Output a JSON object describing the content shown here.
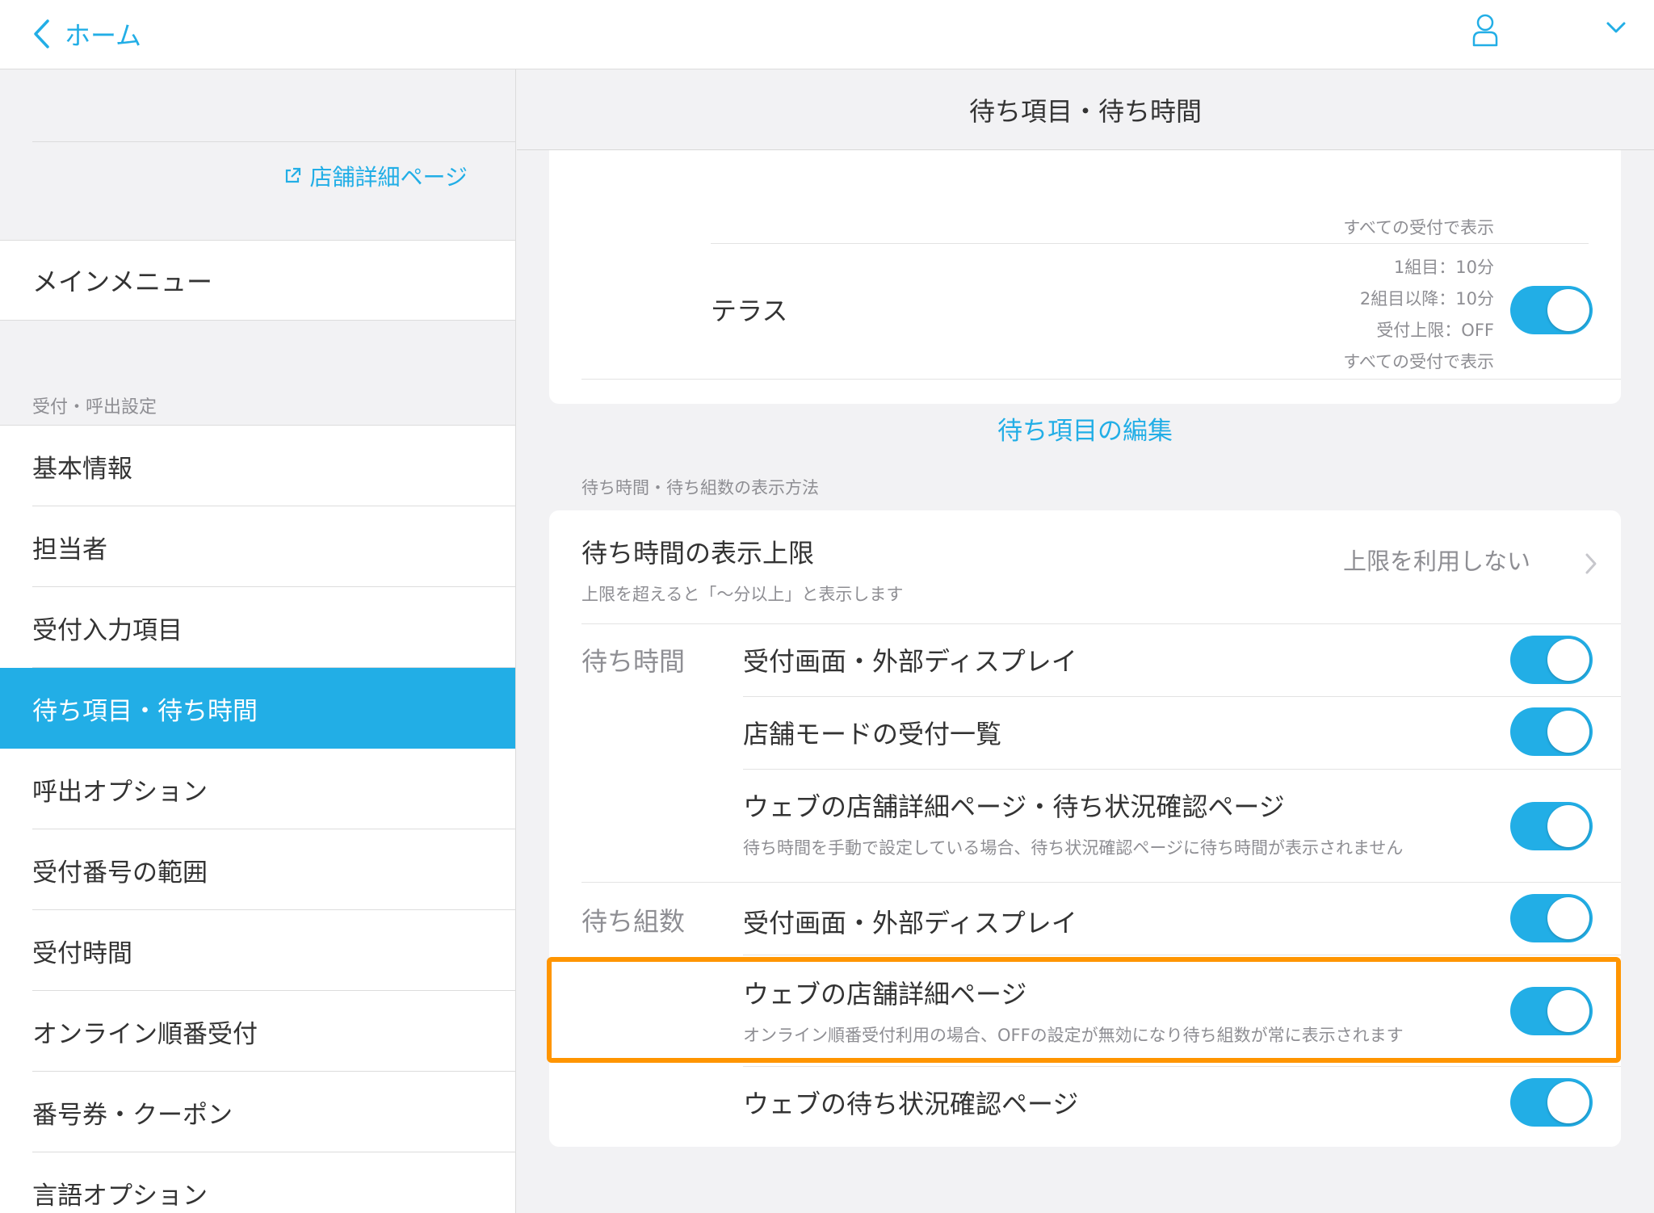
{
  "topbar": {
    "back_label": "ホーム",
    "icons": {
      "back": "chevron-left-icon",
      "user": "user-icon",
      "menu": "chevron-down-icon"
    }
  },
  "sidebar": {
    "shop_link": "店舗詳細ページ",
    "main_menu": "メインメニュー",
    "section_label": "受付・呼出設定",
    "items": [
      {
        "label": "基本情報"
      },
      {
        "label": "担当者"
      },
      {
        "label": "受付入力項目"
      },
      {
        "label": "待ち項目・待ち時間",
        "active": true
      },
      {
        "label": "呼出オプション"
      },
      {
        "label": "受付番号の範囲"
      },
      {
        "label": "受付時間"
      },
      {
        "label": "オンライン順番受付"
      },
      {
        "label": "番号券・クーポン"
      },
      {
        "label": "言語オプション"
      }
    ]
  },
  "content": {
    "title": "待ち項目・待ち時間",
    "wait_items": {
      "clipped_text": "すべての受付で表示",
      "terrace": {
        "label": "テラス",
        "info": [
          "1組目：10分",
          "2組目以降：10分",
          "受付上限：OFF",
          "すべての受付で表示"
        ],
        "enabled": true
      },
      "edit_link": "待ち項目の編集"
    },
    "display_section": {
      "label": "待ち時間・待ち組数の表示方法",
      "limit": {
        "title": "待ち時間の表示上限",
        "subtitle": "上限を超えると「〜分以上」と表示します",
        "value": "上限を利用しない"
      },
      "wait_time": {
        "label": "待ち時間",
        "rows": [
          {
            "title": "受付画面・外部ディスプレイ",
            "enabled": true
          },
          {
            "title": "店舗モードの受付一覧",
            "enabled": true
          },
          {
            "title": "ウェブの店舗詳細ページ・待ち状況確認ページ",
            "subtitle": "待ち時間を手動で設定している場合、待ち状況確認ページに待ち時間が表示されません",
            "enabled": true
          }
        ]
      },
      "wait_count": {
        "label": "待ち組数",
        "rows": [
          {
            "title": "受付画面・外部ディスプレイ",
            "enabled": true
          },
          {
            "title": "ウェブの店舗詳細ページ",
            "subtitle": "オンライン順番受付利用の場合、OFFの設定が無効になり待ち組数が常に表示されます",
            "enabled": true,
            "highlighted": true
          },
          {
            "title": "ウェブの待ち状況確認ページ",
            "enabled": true
          }
        ]
      }
    }
  },
  "colors": {
    "accent": "#22aee6",
    "highlight": "#ff9500",
    "background": "#f2f2f4"
  }
}
